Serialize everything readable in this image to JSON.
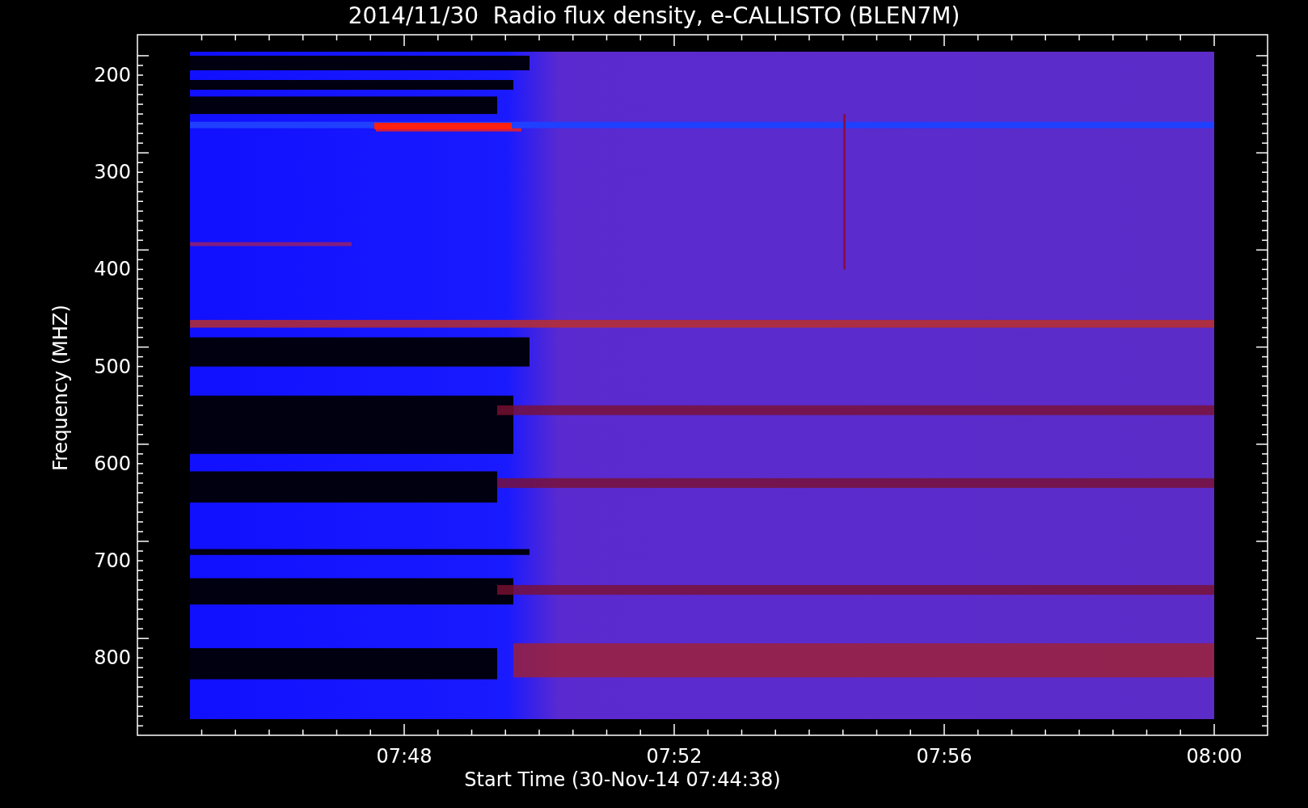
{
  "title": "2014/11/30  Radio flux density, e-CALLISTO (BLEN7M)",
  "y_axis": {
    "label": "Frequency (MHZ)",
    "ticks": [
      "200",
      "300",
      "400",
      "500",
      "600",
      "700",
      "800"
    ]
  },
  "x_axis": {
    "label": "Start Time (30-Nov-14 07:44:38)",
    "ticks": [
      "07:48",
      "07:52",
      "07:56",
      "08:00"
    ]
  }
}
